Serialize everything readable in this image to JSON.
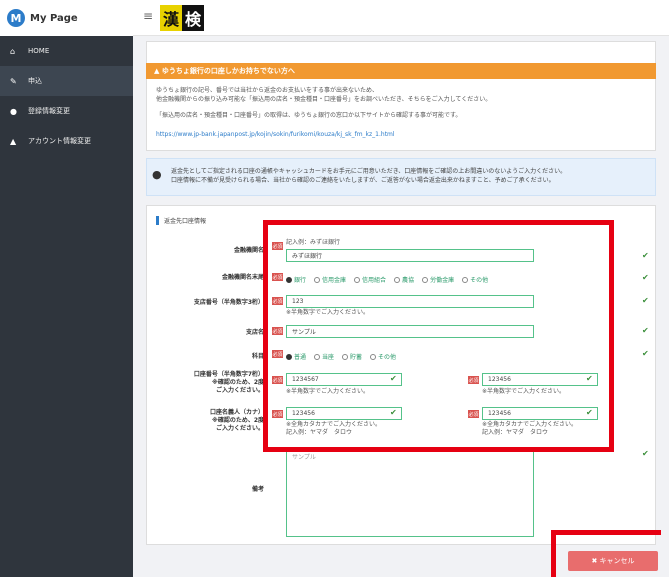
{
  "app": {
    "title": "My Page",
    "logo_letter": "M"
  },
  "brand_logo": {
    "left": "漢",
    "right": "検"
  },
  "nav": [
    {
      "icon": "home-icon",
      "glyph": "⌂",
      "label": "HOME"
    },
    {
      "icon": "pencil-icon",
      "glyph": "✎",
      "label": "申込"
    },
    {
      "icon": "user-icon",
      "glyph": "●",
      "label": "登録情報変更"
    },
    {
      "icon": "lock-icon",
      "glyph": "▲",
      "label": "アカウント情報変更"
    }
  ],
  "notice": {
    "heading": "▲ ゆうちょ銀行の口座しかお持ちでない方へ",
    "line1": "ゆうちょ銀行の記号、番号では当社から返金のお支払いをする事が出来ないため、",
    "line2": "他金融機関からの振り込み可能な「振込用の店名・預金種目・口座番号」をお調べいただき、そちらをご入力してください。",
    "line3": "「振込用の店名・預金種目・口座番号」の取得は、ゆうちょ銀行の窓口か以下サイトから確認する事が可能です。",
    "url": "https://www.jp-bank.japanpost.jp/kojin/sokin/furikomi/kouza/kj_sk_fm_kz_1.html"
  },
  "info": {
    "line1": "返金先としてご指定される口座の通帳やキャッシュカードをお手元にご用意いただき、口座情報をご確認の上お間違いのないようご入力ください。",
    "line2": "口座情報に不備が見受けられる場合、当社から確認のご連絡をいたしますが、ご返答がない場合返金出来かねますこと、予めご了承ください。"
  },
  "form": {
    "section_title": "返金先口座情報",
    "required_badge": "必須",
    "bank_label": "金融機関名",
    "bank_example": "記入例：みずほ銀行",
    "bank_value": "みずほ銀行",
    "type_label": "金融機関名末尾",
    "type_options": [
      "銀行",
      "信用金庫",
      "信用組合",
      "農協",
      "労働金庫",
      "その他"
    ],
    "branch_no_label": "支店番号（半角数字3桁）",
    "branch_no_value": "123",
    "halfwidth_hint": "※半角数字でご入力ください。",
    "branch_label": "支店名",
    "branch_placeholder": "サンプル",
    "account_type_label": "科目",
    "account_types": [
      "普通",
      "当座",
      "貯蓄",
      "その他"
    ],
    "account_no_label_1": "口座番号（半角数字7桁）",
    "account_no_label_2": "※確認のため、2度",
    "account_no_label_3": "ご入力ください。",
    "account_no_value": "1234567",
    "account_no_confirm": "123456",
    "holder_label_1": "口座名義人（カナ）",
    "holder_label_2": "※確認のため、2度",
    "holder_label_3": "ご入力ください。",
    "holder_value": "123456",
    "holder_confirm": "123456",
    "kana_hint": "※全角カタカナでご入力ください。",
    "kana_example": "記入例：ヤマダ　タロウ",
    "notes_label": "備考",
    "notes_placeholder": "サンプル"
  },
  "buttons": {
    "cancel": "✖ キャンセル"
  }
}
